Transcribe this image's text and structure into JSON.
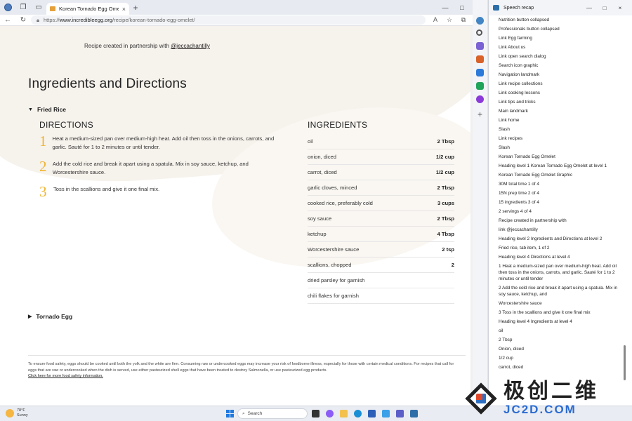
{
  "browser": {
    "tab_title": "Korean Tornado Egg Omelet - A",
    "url_prefix": "https://",
    "url_domain": "www.incredibleegg.org",
    "url_path": "/recipe/korean-tornado-egg-omelet/",
    "new_tab_glyph": "+",
    "close_glyph": "×",
    "minimize_glyph": "—",
    "maximize_glyph": "□"
  },
  "page": {
    "partner_prefix": "Recipe created in partnership with ",
    "partner_link": "@jeccachantilly",
    "heading": "Ingredients and Directions",
    "fried_rice_tab": "Fried Rice",
    "tornado_egg_tab": "Tornado Egg",
    "directions_heading": "DIRECTIONS",
    "ingredients_heading": "INGREDIENTS",
    "steps": [
      {
        "num": "1",
        "text": "Heat a medium-sized pan over medium-high heat. Add oil then toss in the onions, carrots, and garlic. Sauté for 1 to 2 minutes or until tender."
      },
      {
        "num": "2",
        "text": "Add the cold rice and break it apart using a spatula. Mix in soy sauce, ketchup, and Worcestershire sauce."
      },
      {
        "num": "3",
        "text": "Toss in the scallions and give it one final mix."
      }
    ],
    "ingredients": [
      {
        "name": "oil",
        "amount": "2 Tbsp"
      },
      {
        "name": "onion, diced",
        "amount": "1/2 cup"
      },
      {
        "name": "carrot, diced",
        "amount": "1/2 cup"
      },
      {
        "name": "garlic cloves, minced",
        "amount": "2 Tbsp"
      },
      {
        "name": "cooked rice, preferably cold",
        "amount": "3 cups"
      },
      {
        "name": "soy sauce",
        "amount": "2 Tbsp"
      },
      {
        "name": "ketchup",
        "amount": "4 Tbsp"
      },
      {
        "name": "Worcestershire sauce",
        "amount": "2 tsp"
      },
      {
        "name": "scallions, chopped",
        "amount": "2"
      },
      {
        "name": "dried parsley for garnish",
        "amount": ""
      },
      {
        "name": "chili flakes for garnish",
        "amount": ""
      }
    ],
    "footer_text": "To ensure food safety, eggs should be cooked until both the yolk and the white are firm. Consuming raw or undercooked eggs may increase your risk of foodborne illness, especially for those with certain medical conditions. For recipes that call for eggs that are raw or undercooked when the dish is served, use either pasteurized shell eggs that have been treated to destroy Salmonella, or use pasteurized egg products.",
    "footer_link": "Click here for more food safety information."
  },
  "panel": {
    "title": "Speech recap",
    "items": [
      "Nutrition button collapsed",
      "Professionals button collapsed",
      "Link Egg farming",
      "Link About us",
      "Link open search dialog",
      "Search icon graphic",
      "Navigation landmark",
      "Link recipe collections",
      "Link cooking lessons",
      "Link tips and tricks",
      "Main landmark",
      "Link home",
      "Slash",
      "Link recipes",
      "Slash",
      "Korean Tornado Egg Omelet",
      "Heading level 1 Korean Tornado Egg Omelet at level 1",
      "Korean Tornado Egg Omelet Graphic",
      "30M total time 1 of 4",
      "15N prep time 2 of 4",
      "15 ingredients 3 of 4",
      "2 servings 4 of 4",
      "Recipe created in partnership with",
      "link @jeccachantilly",
      "Heading level 2 Ingredients and Directions at level 2",
      "Fried rice, tab item, 1 of 2",
      "Heading level 4 Directions at level 4",
      "1 Heat a medium-sized pan over medium-high heat. Add oil then toss in the onions, carrots, and garlic. Sauté for 1 to 2 minutes or until tender",
      "2 Add the cold rice and break it apart using a spatula. Mix in soy sauce, ketchup, and",
      "Worcestershire sauce",
      "3 Toss in the scallions and give it one final mix",
      "Heading level 4 Ingredients at level 4",
      "oil",
      "2 Tbsp",
      "Onion, diced",
      "1/2 cup",
      "carrot, diced"
    ]
  },
  "taskbar": {
    "temp": "78°F",
    "condition": "Sunny",
    "search_label": "Search"
  },
  "watermark": {
    "cn": "极创二维",
    "en": "JC2D.COM"
  },
  "colors": {
    "accent_number": "#f0b430",
    "watermark_blue": "#2a6bd1"
  }
}
